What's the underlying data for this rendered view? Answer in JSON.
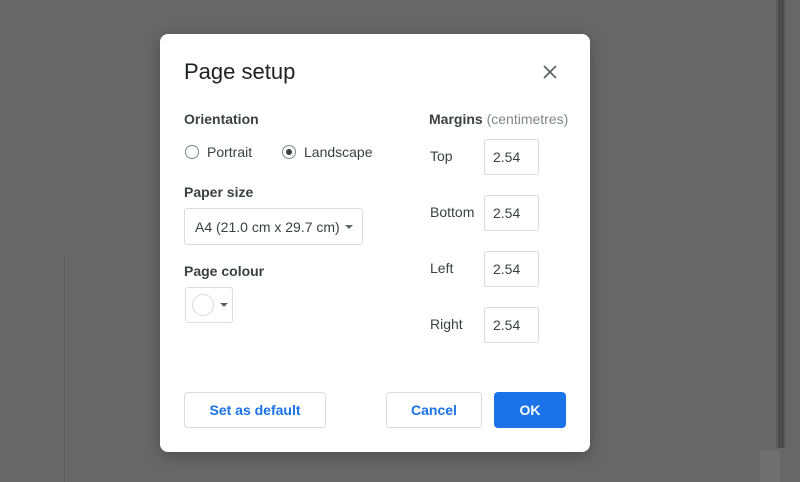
{
  "dialog": {
    "title": "Page setup",
    "close_icon": "close-icon"
  },
  "orientation": {
    "label": "Orientation",
    "options": [
      {
        "label": "Portrait",
        "selected": false
      },
      {
        "label": "Landscape",
        "selected": true
      }
    ]
  },
  "paper_size": {
    "label": "Paper size",
    "value": "A4 (21.0 cm x 29.7 cm)"
  },
  "page_colour": {
    "label": "Page colour",
    "value": "#ffffff"
  },
  "margins": {
    "label": "Margins",
    "unit": "(centimetres)",
    "fields": [
      {
        "label": "Top",
        "value": "2.54"
      },
      {
        "label": "Bottom",
        "value": "2.54"
      },
      {
        "label": "Left",
        "value": "2.54"
      },
      {
        "label": "Right",
        "value": "2.54"
      }
    ]
  },
  "buttons": {
    "set_default": "Set as default",
    "cancel": "Cancel",
    "ok": "OK"
  },
  "colors": {
    "accent": "#1a73e8",
    "backdrop": "#676767"
  }
}
